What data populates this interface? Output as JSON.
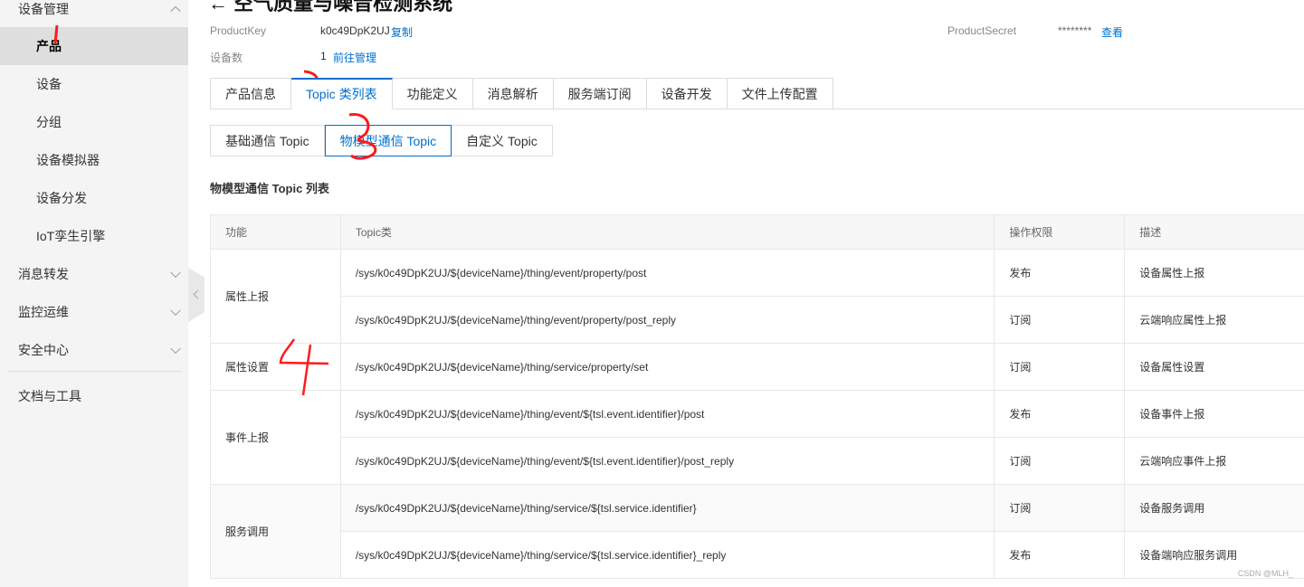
{
  "sidebar": {
    "groups": [
      {
        "label": "设备管理",
        "expanded": true
      },
      {
        "label": "消息转发",
        "expanded": false
      },
      {
        "label": "监控运维",
        "expanded": false
      },
      {
        "label": "安全中心",
        "expanded": false
      }
    ],
    "items": [
      {
        "label": "产品",
        "active": true
      },
      {
        "label": "设备"
      },
      {
        "label": "分组"
      },
      {
        "label": "设备模拟器"
      },
      {
        "label": "设备分发"
      },
      {
        "label": "IoT孪生引擎"
      }
    ],
    "docs_label": "文档与工具"
  },
  "header": {
    "title": "← 空气质量与噪音检测系统"
  },
  "info": {
    "product_key_label": "ProductKey",
    "product_key_value": "k0c49DpK2UJ",
    "copy_link": "复制",
    "device_count_label": "设备数",
    "device_count_value": "1",
    "manage_link": "前往管理",
    "product_secret_label": "ProductSecret",
    "product_secret_value": "********",
    "view_link": "查看"
  },
  "tabs": [
    {
      "label": "产品信息"
    },
    {
      "label": "Topic 类列表",
      "active": true
    },
    {
      "label": "功能定义"
    },
    {
      "label": "消息解析"
    },
    {
      "label": "服务端订阅"
    },
    {
      "label": "设备开发"
    },
    {
      "label": "文件上传配置"
    }
  ],
  "subtabs": [
    {
      "label": "基础通信 Topic"
    },
    {
      "label": "物模型通信 Topic",
      "active": true
    },
    {
      "label": "自定义 Topic"
    }
  ],
  "section_title": "物模型通信 Topic 列表",
  "table": {
    "headers": [
      "功能",
      "Topic类",
      "操作权限",
      "描述"
    ],
    "groups": [
      {
        "function": "属性上报",
        "rows": [
          {
            "topic": "/sys/k0c49DpK2UJ/${deviceName}/thing/event/property/post",
            "permission": "发布",
            "desc": "设备属性上报"
          },
          {
            "topic": "/sys/k0c49DpK2UJ/${deviceName}/thing/event/property/post_reply",
            "permission": "订阅",
            "desc": "云端响应属性上报"
          }
        ]
      },
      {
        "function": "属性设置",
        "rows": [
          {
            "topic": "/sys/k0c49DpK2UJ/${deviceName}/thing/service/property/set",
            "permission": "订阅",
            "desc": "设备属性设置"
          }
        ]
      },
      {
        "function": "事件上报",
        "rows": [
          {
            "topic": "/sys/k0c49DpK2UJ/${deviceName}/thing/event/${tsl.event.identifier}/post",
            "permission": "发布",
            "desc": "设备事件上报"
          },
          {
            "topic": "/sys/k0c49DpK2UJ/${deviceName}/thing/event/${tsl.event.identifier}/post_reply",
            "permission": "订阅",
            "desc": "云端响应事件上报"
          }
        ]
      },
      {
        "function": "服务调用",
        "rows": [
          {
            "topic": "/sys/k0c49DpK2UJ/${deviceName}/thing/service/${tsl.service.identifier}",
            "permission": "订阅",
            "desc": "设备服务调用"
          },
          {
            "topic": "/sys/k0c49DpK2UJ/${deviceName}/thing/service/${tsl.service.identifier}_reply",
            "permission": "发布",
            "desc": "设备端响应服务调用"
          }
        ]
      }
    ]
  },
  "annotations": {
    "color": "#ff1a1a",
    "marks": [
      "1",
      "2",
      "3",
      "4"
    ]
  },
  "watermark": "CSDN @MLH_"
}
